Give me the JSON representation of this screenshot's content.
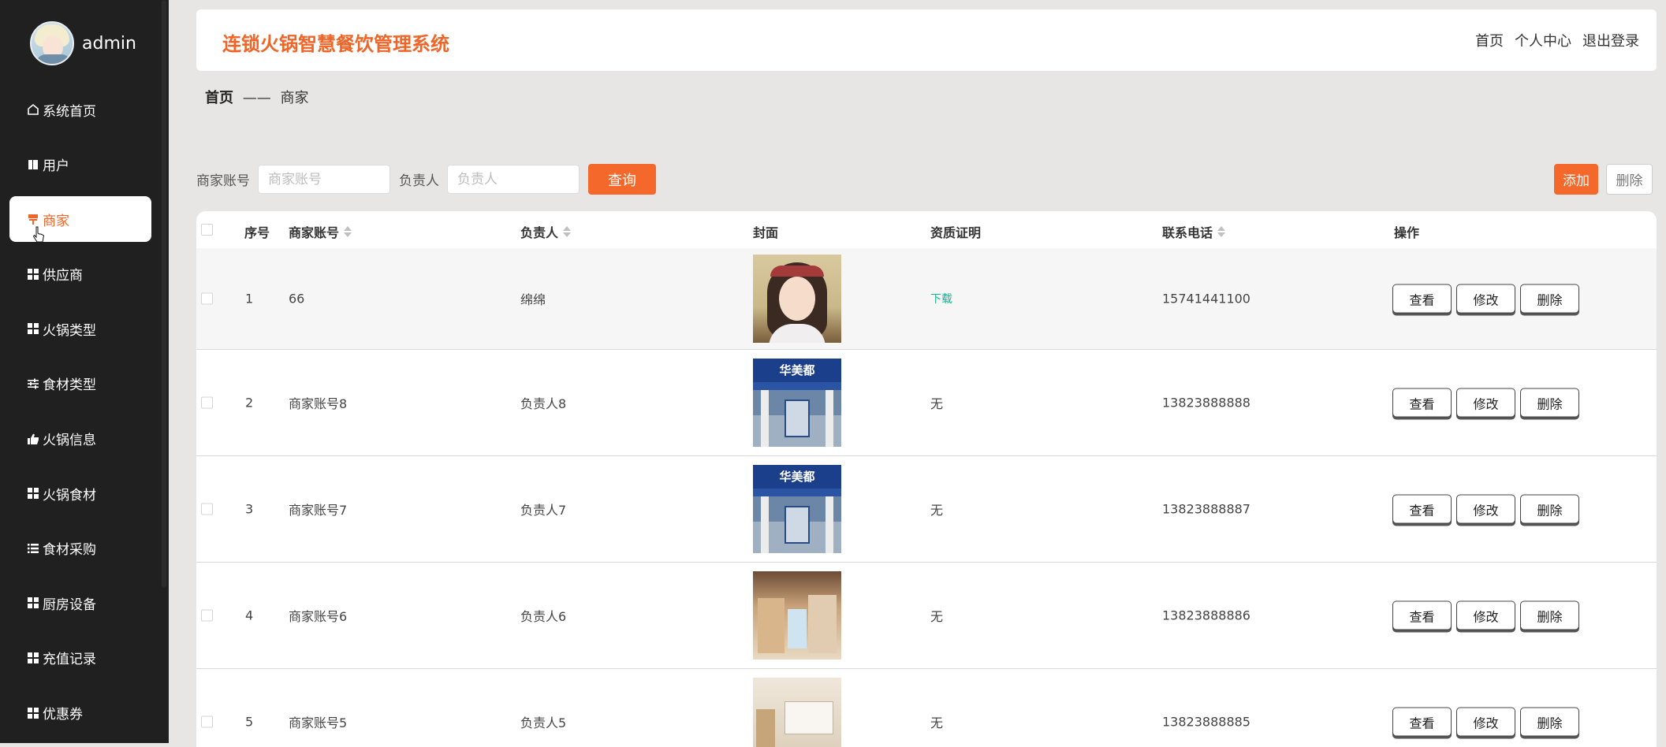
{
  "user": {
    "name": "admin"
  },
  "sidebar": {
    "items": [
      {
        "label": "系统首页",
        "icon": "home-icon",
        "active": false
      },
      {
        "label": "用户",
        "icon": "book-icon",
        "active": false
      },
      {
        "label": "商家",
        "icon": "shop-icon",
        "active": true
      },
      {
        "label": "供应商",
        "icon": "grid-icon",
        "active": false
      },
      {
        "label": "火锅类型",
        "icon": "grid-icon",
        "active": false
      },
      {
        "label": "食材类型",
        "icon": "sliders-icon",
        "active": false
      },
      {
        "label": "火锅信息",
        "icon": "thumb-icon",
        "active": false
      },
      {
        "label": "火锅食材",
        "icon": "grid-icon",
        "active": false
      },
      {
        "label": "食材采购",
        "icon": "list-icon",
        "active": false
      },
      {
        "label": "厨房设备",
        "icon": "grid-icon",
        "active": false
      },
      {
        "label": "充值记录",
        "icon": "grid-icon",
        "active": false
      },
      {
        "label": "优惠券",
        "icon": "grid-icon",
        "active": false
      }
    ]
  },
  "header": {
    "title": "连锁火锅智慧餐饮管理系统",
    "links": {
      "home": "首页",
      "profile": "个人中心",
      "logout": "退出登录"
    }
  },
  "breadcrumb": {
    "home": "首页",
    "sep": "——",
    "current": "商家"
  },
  "search": {
    "account_label": "商家账号",
    "account_placeholder": "商家账号",
    "account_value": "",
    "owner_label": "负责人",
    "owner_placeholder": "负责人",
    "owner_value": "",
    "query_label": "查询"
  },
  "toolbar": {
    "add_label": "添加",
    "delete_label": "删除"
  },
  "table": {
    "columns": [
      "序号",
      "商家账号",
      "负责人",
      "封面",
      "资质证明",
      "联系电话",
      "操作"
    ],
    "actions": {
      "view": "查看",
      "edit": "修改",
      "delete": "删除"
    },
    "rows": [
      {
        "index": "1",
        "account": "66",
        "owner": "绵绵",
        "certificate": "下载",
        "phone": "15741441100",
        "cover": "girl"
      },
      {
        "index": "2",
        "account": "商家账号8",
        "owner": "负责人8",
        "certificate": "无",
        "phone": "13823888888",
        "cover": "store",
        "cover_text": "华美都"
      },
      {
        "index": "3",
        "account": "商家账号7",
        "owner": "负责人7",
        "certificate": "无",
        "phone": "13823888887",
        "cover": "store",
        "cover_text": "华美都"
      },
      {
        "index": "4",
        "account": "商家账号6",
        "owner": "负责人6",
        "certificate": "无",
        "phone": "13823888886",
        "cover": "shop"
      },
      {
        "index": "5",
        "account": "商家账号5",
        "owner": "负责人5",
        "certificate": "无",
        "phone": "13823888885",
        "cover": "shop2"
      }
    ]
  },
  "colors": {
    "accent": "#f4692b",
    "sidebar_bg": "#202021",
    "link_green": "#19b394"
  }
}
